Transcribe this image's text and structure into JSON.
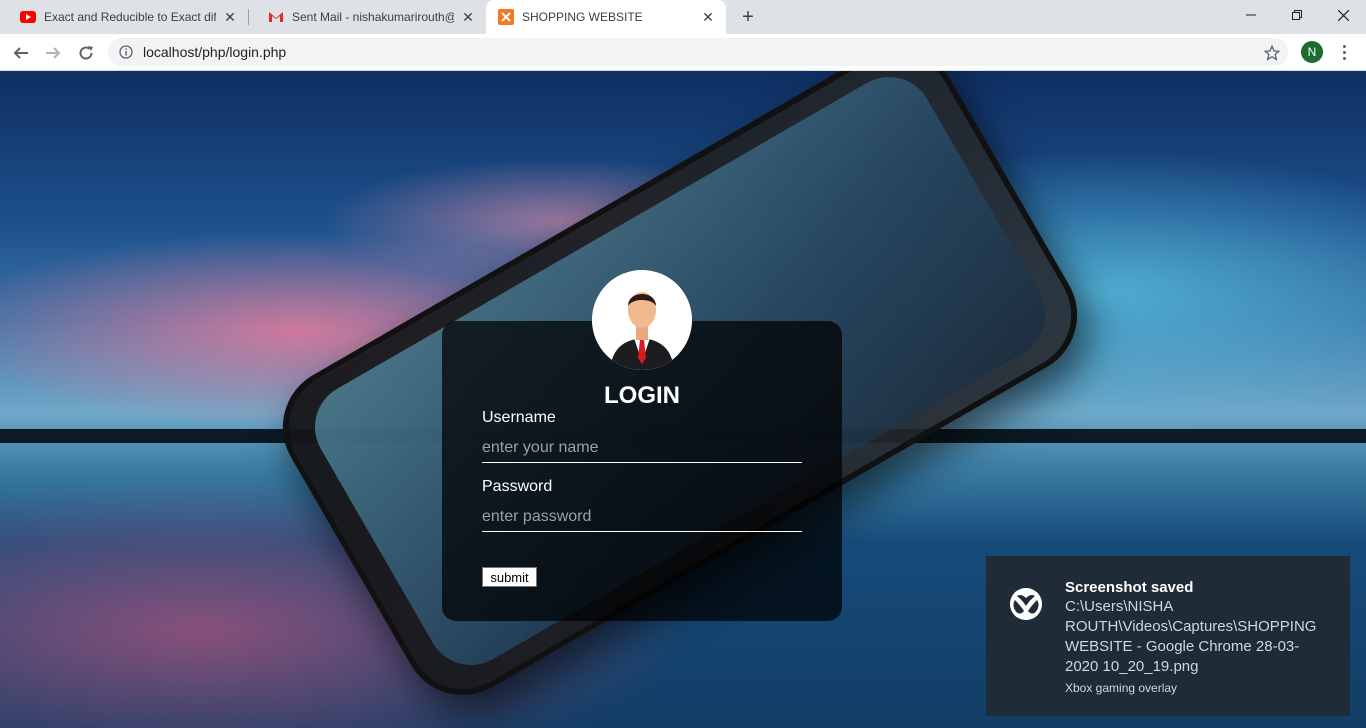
{
  "browser": {
    "tabs": [
      {
        "title": "Exact and Reducible to Exact diffe",
        "favicon": "youtube-icon"
      },
      {
        "title": "Sent Mail - nishakumarirouth@gm",
        "favicon": "gmail-icon"
      },
      {
        "title": "SHOPPING WEBSITE",
        "favicon": "xampp-icon",
        "active": true
      }
    ],
    "url": "localhost/php/login.php",
    "profile_initial": "N"
  },
  "login": {
    "title": "LOGIN",
    "username_label": "Username",
    "username_placeholder": "enter your name",
    "password_label": "Password",
    "password_placeholder": "enter password",
    "submit_label": "submit"
  },
  "toast": {
    "title": "Screenshot saved",
    "body": "C:\\Users\\NISHA ROUTH\\Videos\\Captures\\SHOPPING WEBSITE - Google Chrome 28-03-2020 10_20_19.png",
    "source": "Xbox gaming overlay"
  },
  "colors": {
    "tabstrip": "#dee1e6",
    "card_bg": "rgba(0,0,0,0.72)",
    "toast_bg": "#1f2c37",
    "avatar_green": "#1e6b2f"
  }
}
